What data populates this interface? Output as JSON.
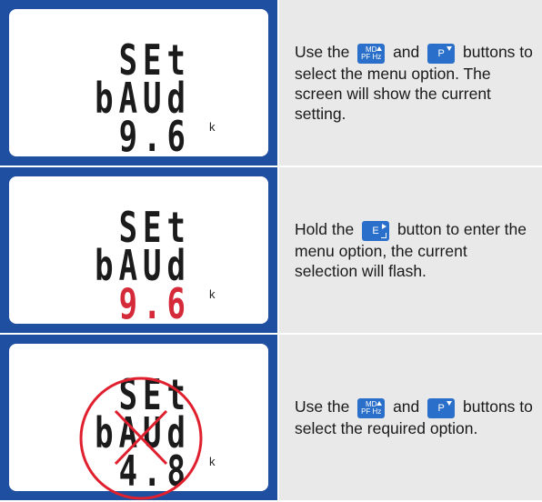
{
  "rows": [
    {
      "lcd": {
        "line1": "SEt",
        "line2": "bAUd",
        "line3": "9.6",
        "unit": "k",
        "line3_color": "#1b1b1b"
      },
      "instruction": {
        "pre": "Use the",
        "mid": "and",
        "post": "buttons to select the menu option. The screen will show the current setting."
      }
    },
    {
      "lcd": {
        "line1": "SEt",
        "line2": "bAUd",
        "line3": "9.6",
        "unit": "k",
        "line3_color": "#d42a3a"
      },
      "instruction": {
        "pre": "Hold the",
        "post": "button to enter the menu option, the current selection will flash."
      }
    },
    {
      "lcd": {
        "line1": "SEt",
        "line2": "bAUd",
        "line3": "4.8",
        "unit": "k",
        "line3_color": "#1b1b1b"
      },
      "instruction": {
        "pre": "Use the",
        "mid": "and",
        "post": "buttons to select the required option."
      }
    }
  ],
  "buttons": {
    "mdpf_top": "MD",
    "mdpf_bottom": "PF Hz",
    "p": "P",
    "e": "E"
  },
  "colors": {
    "panel_blue": "#1f4fa0",
    "button_blue": "#2a6fc9",
    "flash_red": "#d42a3a",
    "cross_red": "#e0202e"
  },
  "icons": [
    "triangle-up-icon",
    "triangle-down-icon",
    "triangle-right-icon",
    "enter-arrow-icon",
    "crossed-circle-icon"
  ]
}
